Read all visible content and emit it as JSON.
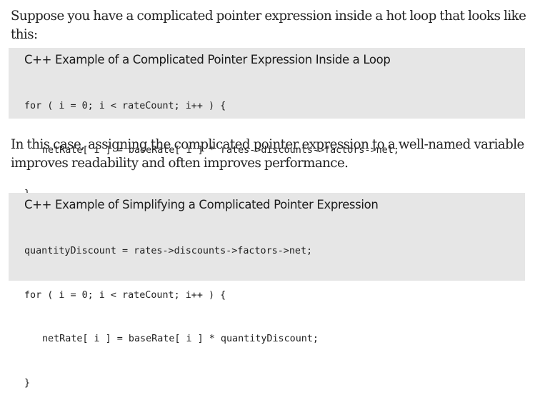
{
  "paragraphs": {
    "intro": "Suppose you have a complicated pointer expression inside a hot loop that looks like this:",
    "explanation": "In this case, assigning the complicated pointer expression to a well-named variable improves readability and often improves performance."
  },
  "examples": [
    {
      "title": "C++ Example of a Complicated Pointer Expression Inside a Loop",
      "code": [
        "for ( i = 0; i < rateCount; i++ ) {",
        "netRate[ i ] = baseRate[ i ] * rates->discounts->factors->net;",
        "}"
      ]
    },
    {
      "title": "C++ Example of Simplifying a Complicated Pointer Expression",
      "code": [
        "quantityDiscount = rates->discounts->factors->net;",
        "for ( i = 0; i < rateCount; i++ ) {",
        "netRate[ i ] = baseRate[ i ] * quantityDiscount;",
        "}"
      ]
    }
  ]
}
